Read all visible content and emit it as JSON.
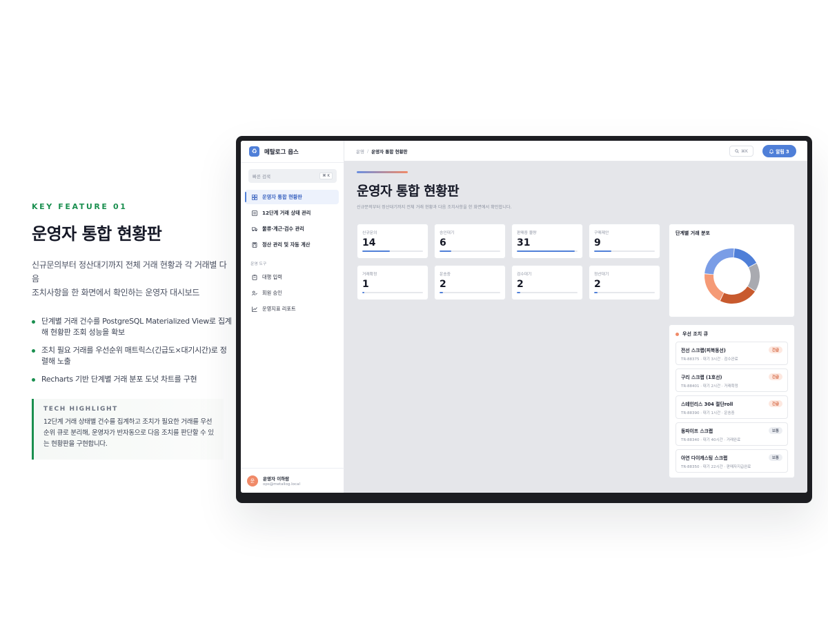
{
  "feature": {
    "tag": "KEY FEATURE 01",
    "title": "운영자 통합 현황판",
    "desc_line1": "신규문의부터 정산대기까지 전체 거래 현황과 각 거래별 다음",
    "desc_line2": "조치사항을 한 화면에서 확인하는 운영자 대시보드",
    "bullets": [
      "단계별 거래 건수를 PostgreSQL Materialized View로 집계해 현황판 조회 성능을 확보",
      "조치 필요 거래를 우선순위 매트릭스(긴급도×대기시간)로 정렬해 노출",
      "Recharts 기반 단계별 거래 분포 도넛 차트를 구현"
    ],
    "tech_label": "TECH HIGHLIGHT",
    "tech_text": "12단계 거래 상태별 건수를 집계하고 조치가 필요한 거래를 우선순위 큐로 분리해, 운영자가 반자동으로 다음 조치를 판단할 수 있는 현황판을 구현합니다."
  },
  "app": {
    "brand": "메탈로그 옵스",
    "quick_search": {
      "label": "빠른 검색",
      "kbd": "⌘ K"
    },
    "nav": [
      {
        "label": "운영자 통합 현황판",
        "icon": "grid-icon"
      },
      {
        "label": "12단계 거래 상태 관리",
        "icon": "list-icon"
      },
      {
        "label": "물류·계근·검수 관리",
        "icon": "truck-icon"
      },
      {
        "label": "정산 관리 및 자동 계산",
        "icon": "calculator-icon"
      }
    ],
    "tools_section": "운영 도구",
    "tools": [
      {
        "label": "대행 입력",
        "icon": "clipboard-icon"
      },
      {
        "label": "회원 승인",
        "icon": "user-check-icon"
      },
      {
        "label": "운영지표 리포트",
        "icon": "chart-icon"
      }
    ],
    "user": {
      "initial": "운",
      "name": "운영자 이하람",
      "email": "ops@metallog.local"
    },
    "breadcrumb": {
      "parent": "운영",
      "current": "운영자 통합 현황판"
    },
    "top_search_kbd": "⌘K",
    "alarm_label": "알림 3",
    "page_title": "운영자 통합 현황판",
    "page_subtitle": "신규문의부터 정산대기까지 전체 거래 현황과 다음 조치사항을 한 화면에서 확인합니다.",
    "kpis": [
      {
        "label": "신규문의",
        "value": "14",
        "ratio": 0.45
      },
      {
        "label": "승인대기",
        "value": "6",
        "ratio": 0.19
      },
      {
        "label": "판매중 물량",
        "value": "31",
        "ratio": 0.95
      },
      {
        "label": "구매제안",
        "value": "9",
        "ratio": 0.28
      },
      {
        "label": "거래확정",
        "value": "1",
        "ratio": 0.03
      },
      {
        "label": "운송중",
        "value": "2",
        "ratio": 0.06
      },
      {
        "label": "검수대기",
        "value": "2",
        "ratio": 0.06
      },
      {
        "label": "정산대기",
        "value": "2",
        "ratio": 0.06
      }
    ],
    "donut_title": "단계별 거래 분포",
    "chart_data": {
      "type": "pie",
      "title": "단계별 거래 분포",
      "variant": "donut",
      "values": [
        16,
        17,
        23,
        19,
        25
      ],
      "colors": [
        "#4f7fd8",
        "#a9aab0",
        "#c85a2e",
        "#f59a76",
        "#7a9de6"
      ]
    },
    "queue_title": "우선 조치 큐",
    "queue": [
      {
        "name": "전선 스크랩(피복동선)",
        "meta": "TR-88375 · 대기 3시간 · 검수완료",
        "badge": "긴급",
        "level": "urgent"
      },
      {
        "name": "구리 스크랩 (1호선)",
        "meta": "TR-88401 · 대기 2시간 · 거래확정",
        "badge": "긴급",
        "level": "urgent"
      },
      {
        "name": "스테인리스 304 절단roll",
        "meta": "TR-88390 · 대기 1시간 · 운송중",
        "badge": "긴급",
        "level": "urgent"
      },
      {
        "name": "동파이프 스크랩",
        "meta": "TR-88340 · 대기 40시간 · 거래완료",
        "badge": "보통",
        "level": "normal"
      },
      {
        "name": "아연 다이캐스팅 스크랩",
        "meta": "TR-88350 · 대기 22시간 · 판매자지급완료",
        "badge": "보통",
        "level": "normal"
      }
    ]
  }
}
